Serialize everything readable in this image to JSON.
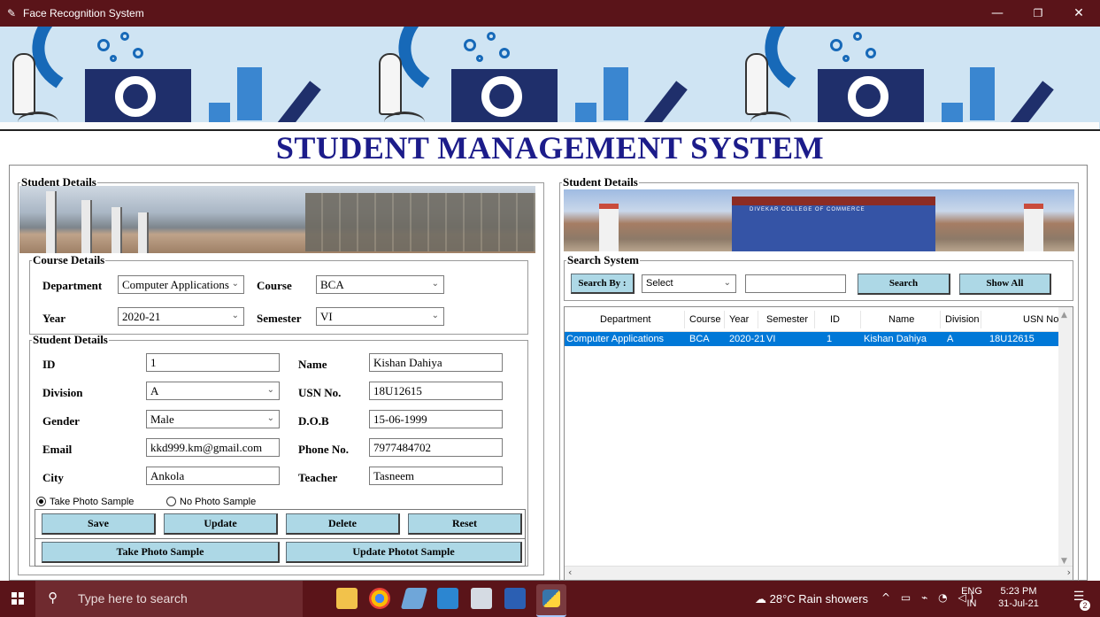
{
  "window": {
    "title": "Face Recognition System",
    "controls": {
      "minimize": "—",
      "maximize": "❐",
      "close": "✕"
    }
  },
  "heading": "STUDENT MANAGEMENT SYSTEM",
  "left_panel": {
    "legend": "Student Details",
    "course_details": {
      "legend": "Course Details",
      "department_label": "Department",
      "department_value": "Computer Applications",
      "course_label": "Course",
      "course_value": "BCA",
      "year_label": "Year",
      "year_value": "2020-21",
      "semester_label": "Semester",
      "semester_value": "VI"
    },
    "student_details": {
      "legend": "Student Details",
      "id_label": "ID",
      "id_value": "1",
      "name_label": "Name",
      "name_value": "Kishan Dahiya",
      "division_label": "Division",
      "division_value": "A",
      "usn_label": "USN No.",
      "usn_value": "18U12615",
      "gender_label": "Gender",
      "gender_value": "Male",
      "dob_label": "D.O.B",
      "dob_value": "15-06-1999",
      "email_label": "Email",
      "email_value": "kkd999.km@gmail.com",
      "phone_label": "Phone No.",
      "phone_value": "7977484702",
      "city_label": "City",
      "city_value": "Ankola",
      "teacher_label": "Teacher",
      "teacher_value": "Tasneem"
    },
    "radios": {
      "take_photo": "Take Photo Sample",
      "no_photo": "No Photo Sample",
      "selected": "take_photo"
    },
    "buttons": {
      "save": "Save",
      "update": "Update",
      "delete": "Delete",
      "reset": "Reset",
      "take_photo": "Take Photo Sample",
      "update_photo": "Update Photot Sample"
    }
  },
  "right_panel": {
    "legend": "Student Details",
    "photo_sign": "DIVEKAR COLLEGE OF COMMERCE",
    "search": {
      "legend": "Search System",
      "search_by_label": "Search By :",
      "search_by_value": "Select",
      "search_text": "",
      "search_button": "Search",
      "show_all_button": "Show All"
    },
    "table": {
      "columns": [
        "Department",
        "Course",
        "Year",
        "Semester",
        "ID",
        "Name",
        "Division",
        "USN No"
      ],
      "rows": [
        [
          "Computer Applications",
          "BCA",
          "2020-21",
          "VI",
          "1",
          "Kishan Dahiya",
          "A",
          "18U12615"
        ]
      ],
      "selected_row": 0
    }
  },
  "taskbar": {
    "search_placeholder": "Type here to search",
    "weather": "28°C  Rain showers",
    "lang_line1": "ENG",
    "lang_line2": "IN",
    "time": "5:23 PM",
    "date": "31-Jul-21",
    "notification_count": "2",
    "apps": [
      "file-explorer",
      "chrome",
      "notepad",
      "vscode",
      "photos",
      "word",
      "python"
    ]
  },
  "colors": {
    "titlebar": "#5a1419",
    "heading": "#1c1c8a",
    "button": "#add8e6",
    "selection": "#0078d7"
  }
}
